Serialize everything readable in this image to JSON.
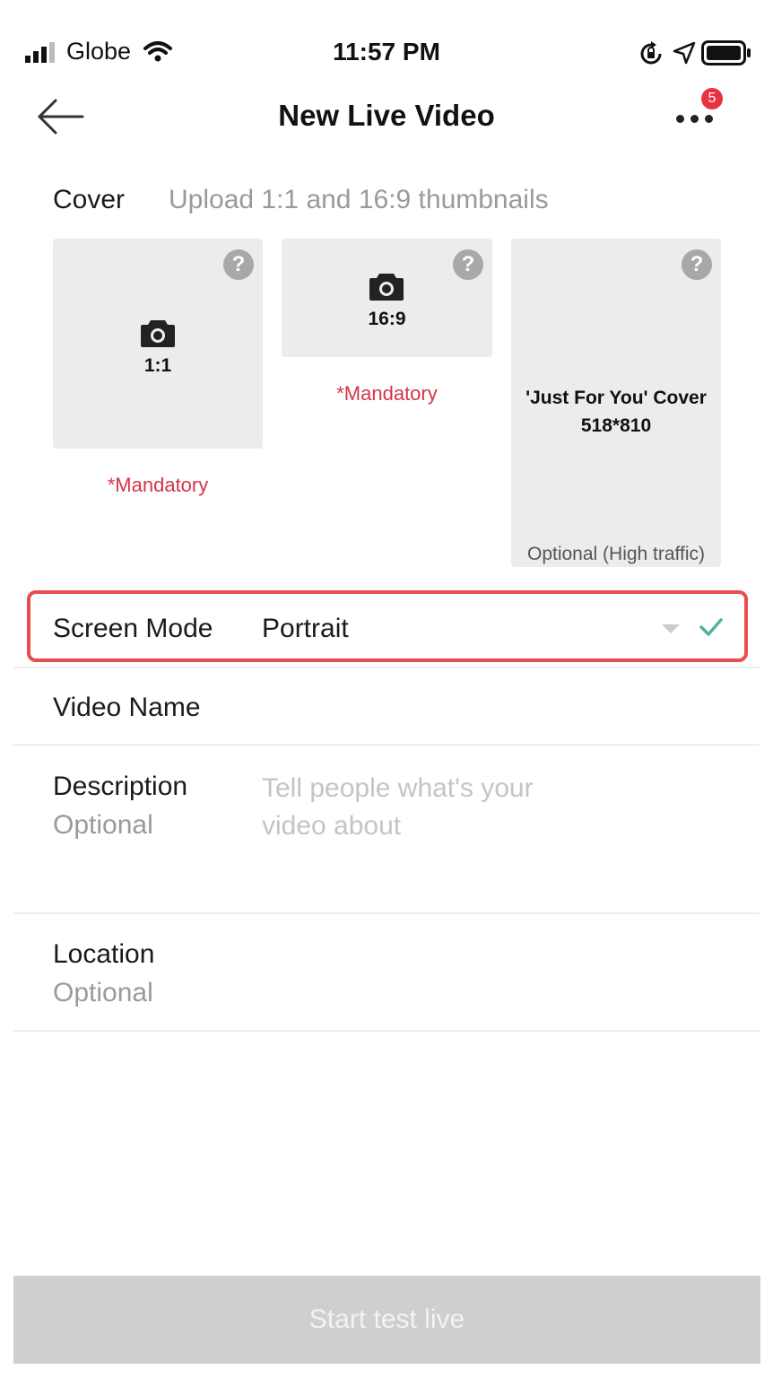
{
  "status_bar": {
    "carrier": "Globe",
    "time": "11:57 PM"
  },
  "header": {
    "title": "New Live Video",
    "notification_count": "5"
  },
  "cover": {
    "label": "Cover",
    "hint": "Upload 1:1 and 16:9 thumbnails",
    "thumbnails": [
      {
        "ratio": "1:1",
        "note": "*Mandatory"
      },
      {
        "ratio": "16:9",
        "note": "*Mandatory"
      },
      {
        "title": "'Just For You' Cover",
        "size": "518*810",
        "note": "Optional (High traffic)"
      }
    ],
    "help_glyph": "?"
  },
  "form": {
    "screen_mode": {
      "label": "Screen Mode",
      "value": "Portrait"
    },
    "video_name": {
      "label": "Video Name"
    },
    "description": {
      "label": "Description",
      "sub": "Optional",
      "placeholder": "Tell people what's your video about"
    },
    "location": {
      "label": "Location",
      "sub": "Optional"
    }
  },
  "footer": {
    "start_label": "Start test live"
  },
  "colors": {
    "mandatory": "#d6334a",
    "highlight_border": "#e84d4f",
    "check": "#4fb3a3",
    "badge": "#e8323f",
    "button_disabled": "#cfcfcf"
  }
}
